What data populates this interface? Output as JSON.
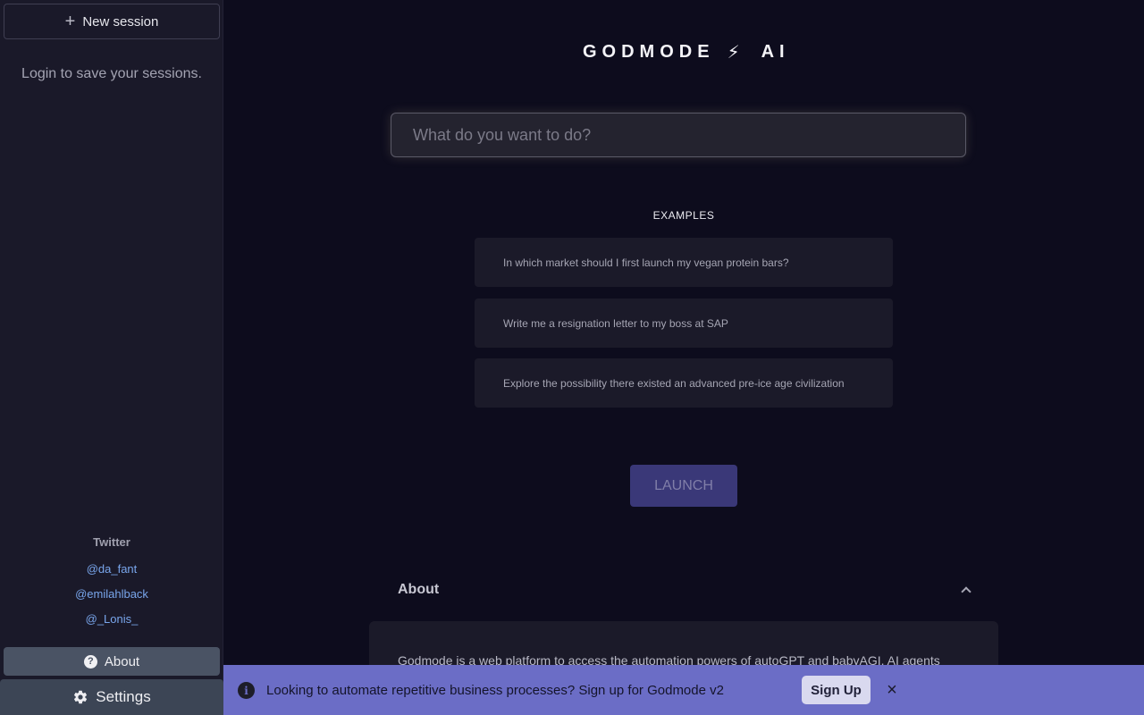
{
  "sidebar": {
    "new_session_label": "New session",
    "login_hint": "Login to save your sessions.",
    "twitter_title": "Twitter",
    "twitter_links": [
      "@da_fant",
      "@emilahlback",
      "@_Lonis_"
    ],
    "about_label": "About",
    "settings_label": "Settings"
  },
  "header": {
    "brand_left": "GODMODE",
    "brand_icon": "⚡",
    "brand_right": "AI"
  },
  "search": {
    "placeholder": "What do you want to do?",
    "value": ""
  },
  "examples": {
    "title": "EXAMPLES",
    "items": [
      "In which market should I first launch my vegan protein bars?",
      "Write me a resignation letter to my boss at SAP",
      "Explore the possibility there existed an advanced pre-ice age civilization"
    ]
  },
  "launch_label": "LAUNCH",
  "about_section": {
    "title": "About",
    "text": "Godmode is a web platform to access the automation powers of autoGPT and babyAGI. AI agents"
  },
  "banner": {
    "text": "Looking to automate repetitive business processes? Sign up for Godmode v2",
    "signup_label": "Sign Up",
    "close_icon": "×"
  },
  "colors": {
    "background": "#0d0c1d",
    "sidebar": "#1a1929",
    "accent_launch": "#3a3878",
    "banner": "#6b6dc6",
    "link": "#79a6ec"
  }
}
